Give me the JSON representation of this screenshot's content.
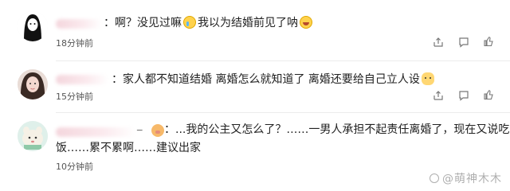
{
  "comments": [
    {
      "avatar": "long-hair-girl-avatar",
      "text_parts": [
        "：啊？没见过嘛",
        "我以为结婚前见了呐"
      ],
      "emojis": [
        "crying-laugh-emoji",
        "laughing-emoji"
      ],
      "time": "18分钟前"
    },
    {
      "avatar": "woman-photo-avatar",
      "text": "：家人都不知道结婚 离婚怎么就知道了 离婚还要给自己立人设",
      "emojis": [
        "cat-emoji"
      ],
      "time": "15分钟前"
    },
    {
      "avatar": "cartoon-character-avatar",
      "username_suffix": "_",
      "badge": "pig-emoji",
      "line1": "：...我的公主又怎么了？……一男人承担不起责任离婚了，现在又说吃不下",
      "line2": "饭……累不累啊……建议出家",
      "time": "10分钟前"
    }
  ],
  "watermark": "@萌神木木",
  "icons": {
    "share": "share-icon",
    "comment": "comment-icon",
    "like": "like-icon"
  }
}
